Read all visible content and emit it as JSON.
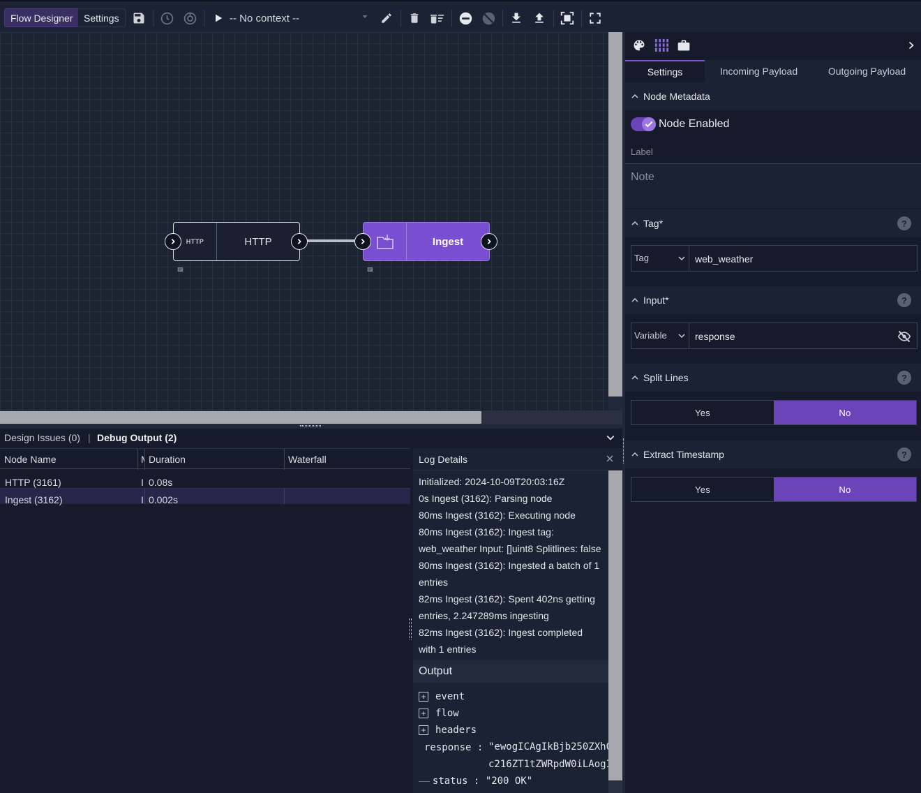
{
  "toolbar": {
    "tab_flow_designer": "Flow Designer",
    "tab_settings": "Settings",
    "context_label": "-- No context --"
  },
  "canvas": {
    "nodes": [
      {
        "icon_text": "HTTP",
        "label": "HTTP"
      },
      {
        "label": "Ingest"
      }
    ]
  },
  "bottom": {
    "tab_design_issues": "Design Issues (0)",
    "tab_debug_output": "Debug Output (2)",
    "columns": [
      "Node Name",
      "M",
      "Duration",
      "Waterfall"
    ],
    "rows": [
      {
        "name": "HTTP (3161)",
        "m": "I",
        "duration": "0.08s"
      },
      {
        "name": "Ingest (3162)",
        "m": "I",
        "duration": "0.002s"
      }
    ]
  },
  "log": {
    "title": "Log Details",
    "lines": [
      "Initialized: 2024-10-09T20:03:16Z",
      "0s Ingest (3162): Parsing node",
      "80ms Ingest (3162): Executing node",
      "80ms Ingest (3162): Ingest tag:",
      "web_weather Input: []uint8 Splitlines: false",
      "80ms Ingest (3162): Ingested a batch of 1",
      "entries",
      "82ms Ingest (3162): Spent 402ns getting",
      "entries, 2.247289ms ingesting",
      "82ms Ingest (3162): Ingest completed",
      "with 1 entries"
    ],
    "output_title": "Output",
    "output_items": [
      "event",
      "flow",
      "headers"
    ],
    "response_key": "response",
    "response_line1": "\"ewogICAgIkBjb250ZXh0",
    "response_line2": "c216ZT1tZWRpdW0iLAogI",
    "status_key": "status",
    "status_value": "\"200 OK\""
  },
  "settings": {
    "tabs": [
      "Settings",
      "Incoming Payload",
      "Outgoing Payload"
    ],
    "node_metadata": "Node Metadata",
    "node_enabled": "Node Enabled",
    "label_placeholder": "Label",
    "note_placeholder": "Note",
    "tag_section": "Tag*",
    "tag_type": "Tag",
    "tag_value": "web_weather",
    "input_section": "Input*",
    "input_type": "Variable",
    "input_value": "response",
    "split_lines": "Split Lines",
    "extract_timestamp": "Extract Timestamp",
    "yes": "Yes",
    "no": "No"
  },
  "colors": {
    "accent": "#6a44b8",
    "ingest_node": "#7a4ed0"
  }
}
